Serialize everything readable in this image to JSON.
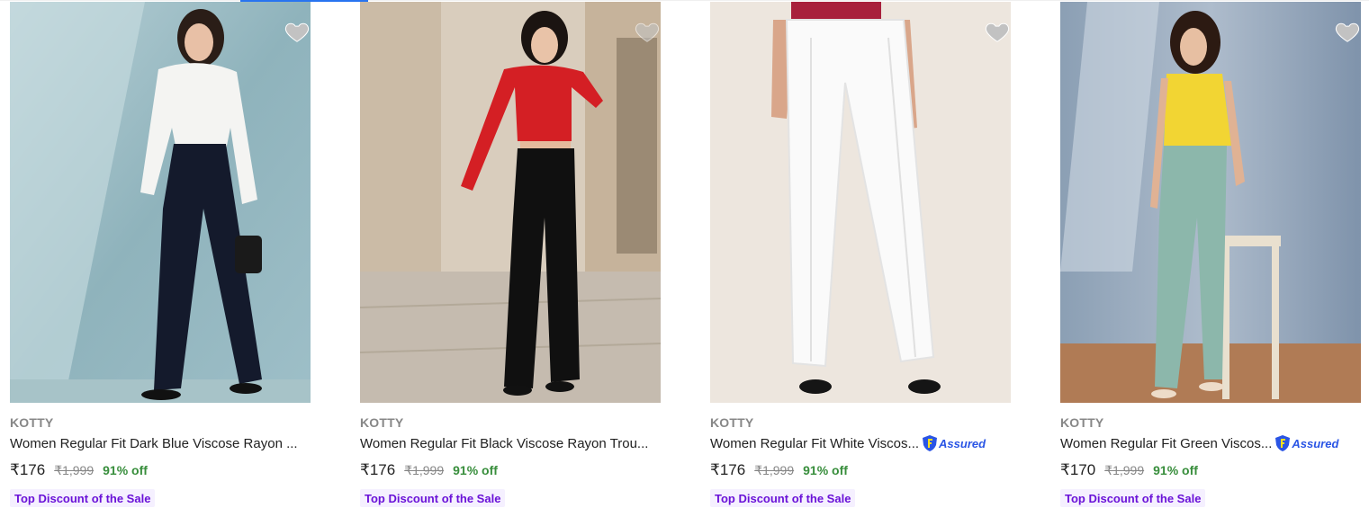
{
  "colors": {
    "accent": "#2874f0",
    "price_discount": "#388e3c",
    "tag_text": "#6a12d8",
    "tag_bg": "#f5f0ff",
    "assured": "#2a55e5"
  },
  "products": [
    {
      "brand": "KOTTY",
      "title": "Women Regular Fit Dark Blue Viscose Rayon ...",
      "assured": false,
      "price": "₹176",
      "mrp": "₹1,999",
      "discount": "91% off",
      "tag": "Top Discount of the Sale",
      "image_icon": "product-photo-dark-blue-trousers"
    },
    {
      "brand": "KOTTY",
      "title": "Women Regular Fit Black Viscose Rayon Trou...",
      "assured": false,
      "price": "₹176",
      "mrp": "₹1,999",
      "discount": "91% off",
      "tag": "Top Discount of the Sale",
      "image_icon": "product-photo-black-trousers"
    },
    {
      "brand": "KOTTY",
      "title": "Women Regular Fit White Viscos...",
      "assured": true,
      "assured_label": "Assured",
      "price": "₹176",
      "mrp": "₹1,999",
      "discount": "91% off",
      "tag": "Top Discount of the Sale",
      "image_icon": "product-photo-white-trousers"
    },
    {
      "brand": "KOTTY",
      "title": "Women Regular Fit Green Viscos...",
      "assured": true,
      "assured_label": "Assured",
      "price": "₹170",
      "mrp": "₹1,999",
      "discount": "91% off",
      "tag": "Top Discount of the Sale",
      "image_icon": "product-photo-green-trousers"
    }
  ]
}
